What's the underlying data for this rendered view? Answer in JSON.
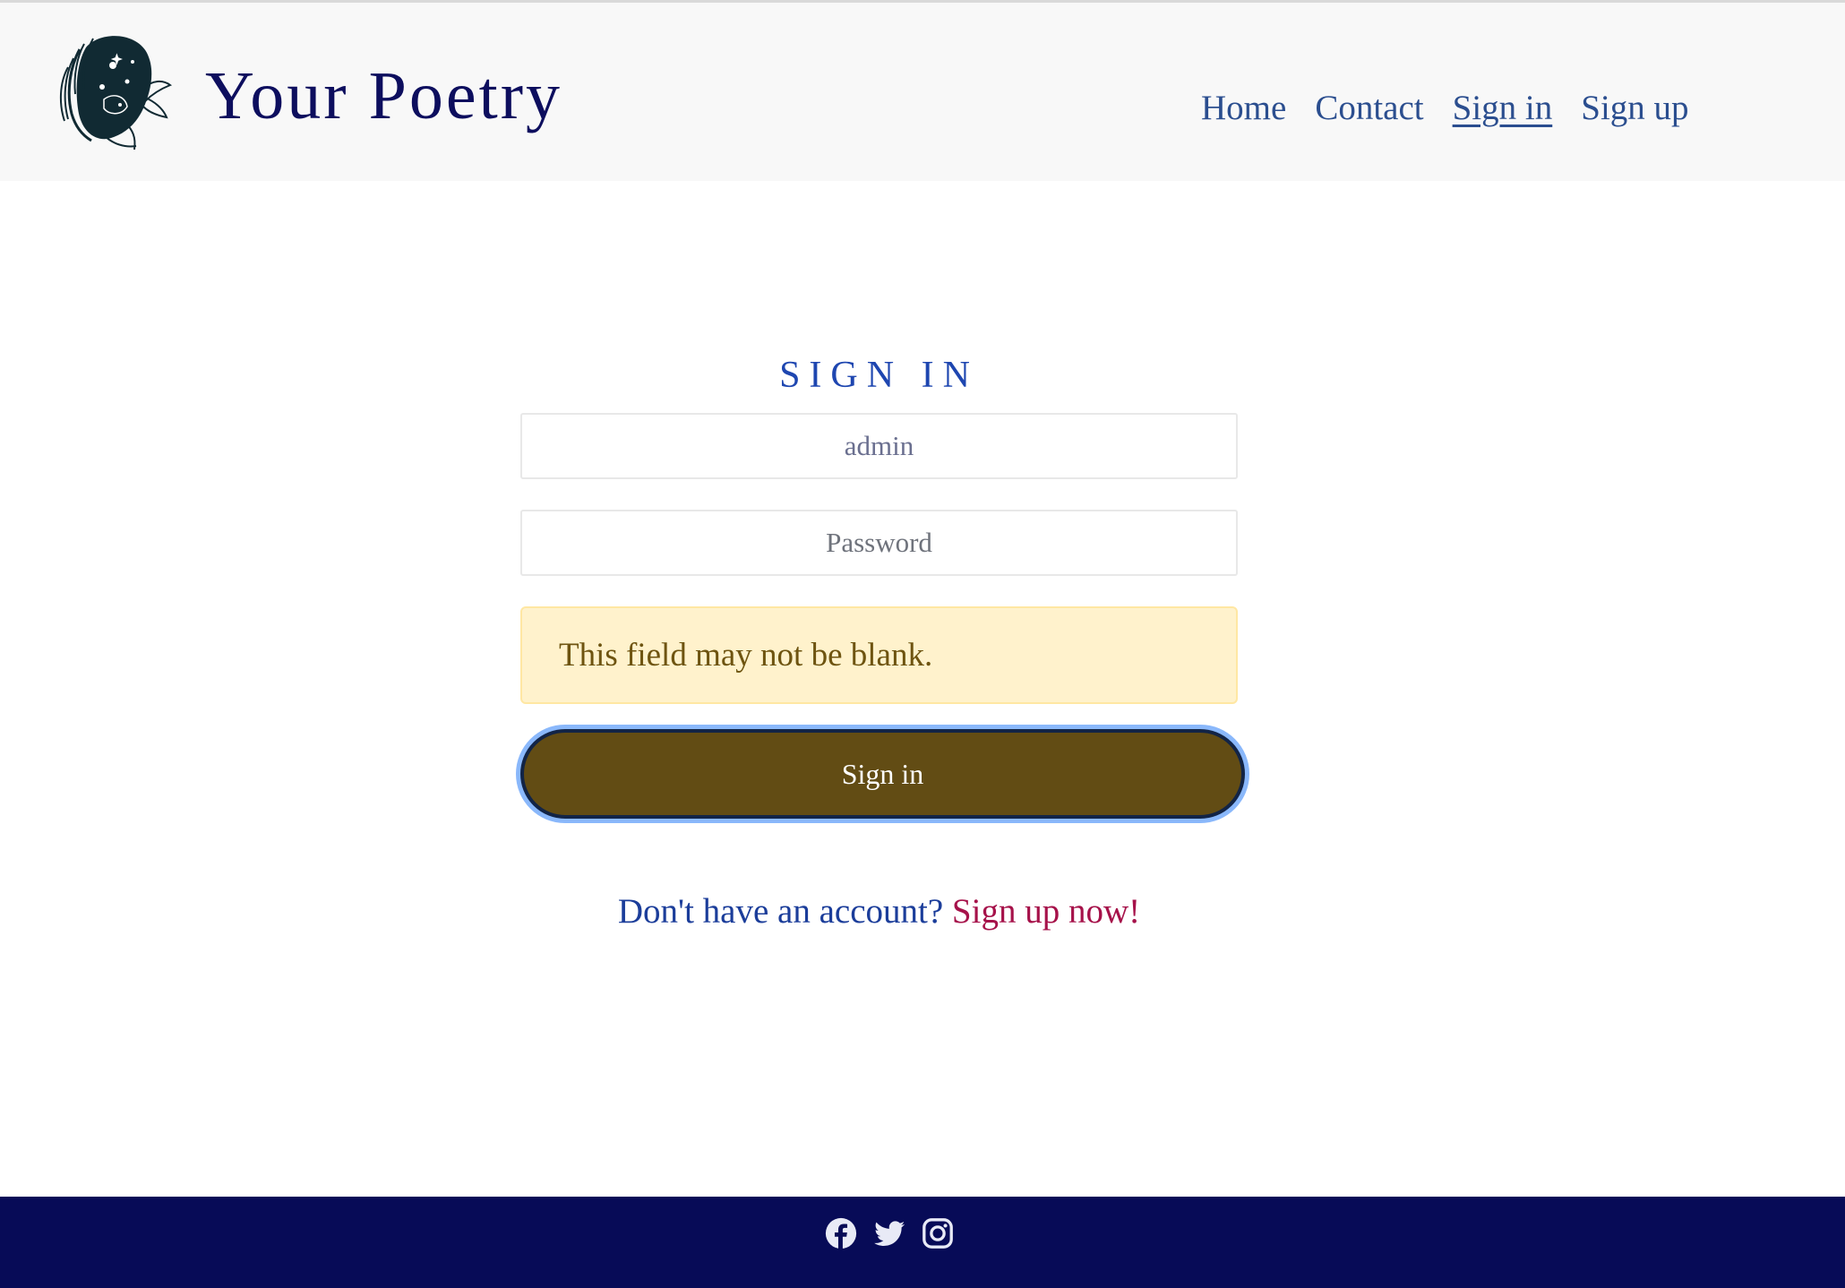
{
  "header": {
    "brand": "Your Poetry",
    "logo_icon": "poet-portrait-logo",
    "nav": [
      {
        "label": "Home",
        "active": false
      },
      {
        "label": "Contact",
        "active": false
      },
      {
        "label": "Sign in",
        "active": true
      },
      {
        "label": "Sign up",
        "active": false
      }
    ]
  },
  "form": {
    "title": "Sign in",
    "username_value": "admin",
    "password_placeholder": "Password",
    "error_message": "This field may not be blank.",
    "submit_label": "Sign in"
  },
  "account": {
    "prefix": "Don't have an account?",
    "link": "Sign up now!"
  },
  "footer": {
    "social_icons": [
      "facebook-icon",
      "twitter-icon",
      "instagram-icon"
    ]
  },
  "colors": {
    "brand": "#0d0e5e",
    "nav_link": "#2b4e8f",
    "title": "#1e46b0",
    "alert_background": "#fff2cc",
    "alert_text": "#6e5410",
    "button": "#624c14",
    "link_accent": "#a6124a",
    "footer": "#070b57"
  }
}
